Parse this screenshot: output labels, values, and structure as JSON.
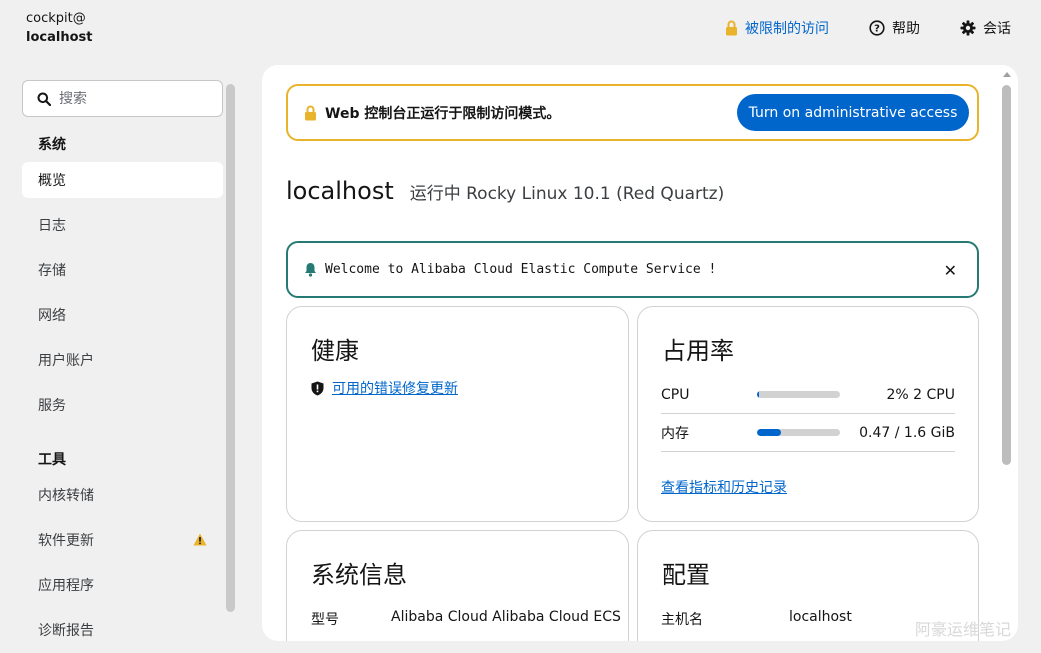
{
  "host": {
    "user": "cockpit@",
    "name": "localhost"
  },
  "topbar": {
    "limited_access": "被限制的访问",
    "help": "帮助",
    "session": "会话"
  },
  "sidebar": {
    "search_placeholder": "搜索",
    "group_system": "系统",
    "group_tools": "工具",
    "items": [
      {
        "label": "概览",
        "active": true
      },
      {
        "label": "日志"
      },
      {
        "label": "存储"
      },
      {
        "label": "网络"
      },
      {
        "label": "用户账户"
      },
      {
        "label": "服务"
      }
    ],
    "tools": [
      {
        "label": "内核转储"
      },
      {
        "label": "软件更新",
        "warning": true
      },
      {
        "label": "应用程序"
      },
      {
        "label": "诊断报告"
      }
    ]
  },
  "main": {
    "limited_alert": "Web 控制台正运行于限制访问模式。",
    "admin_button": "Turn on administrative access",
    "hostname": "localhost",
    "os": "运行中 Rocky Linux 10.1 (Red Quartz)",
    "motd": "Welcome to Alibaba Cloud Elastic Compute Service !",
    "motd_close": "✕",
    "health": {
      "title": "健康",
      "link": "可用的错误修复更新"
    },
    "usage": {
      "title": "占用率",
      "cpu_label": "CPU",
      "cpu_value": "2% 2 CPU",
      "cpu_fraction": 0.02,
      "mem_label": "内存",
      "mem_value": "0.47 / 1.6 GiB",
      "mem_fraction": 0.29,
      "link": "查看指标和历史记录"
    },
    "sysinfo": {
      "title": "系统信息",
      "model_label": "型号",
      "model_value": "Alibaba Cloud Alibaba Cloud ECS"
    },
    "config": {
      "title": "配置",
      "hostname_label": "主机名",
      "hostname_value": "localhost"
    }
  },
  "watermark": "阿豪运维笔记",
  "colors": {
    "accent": "#0066cc",
    "warning": "#e9b32c",
    "motd_border": "#267a73"
  }
}
